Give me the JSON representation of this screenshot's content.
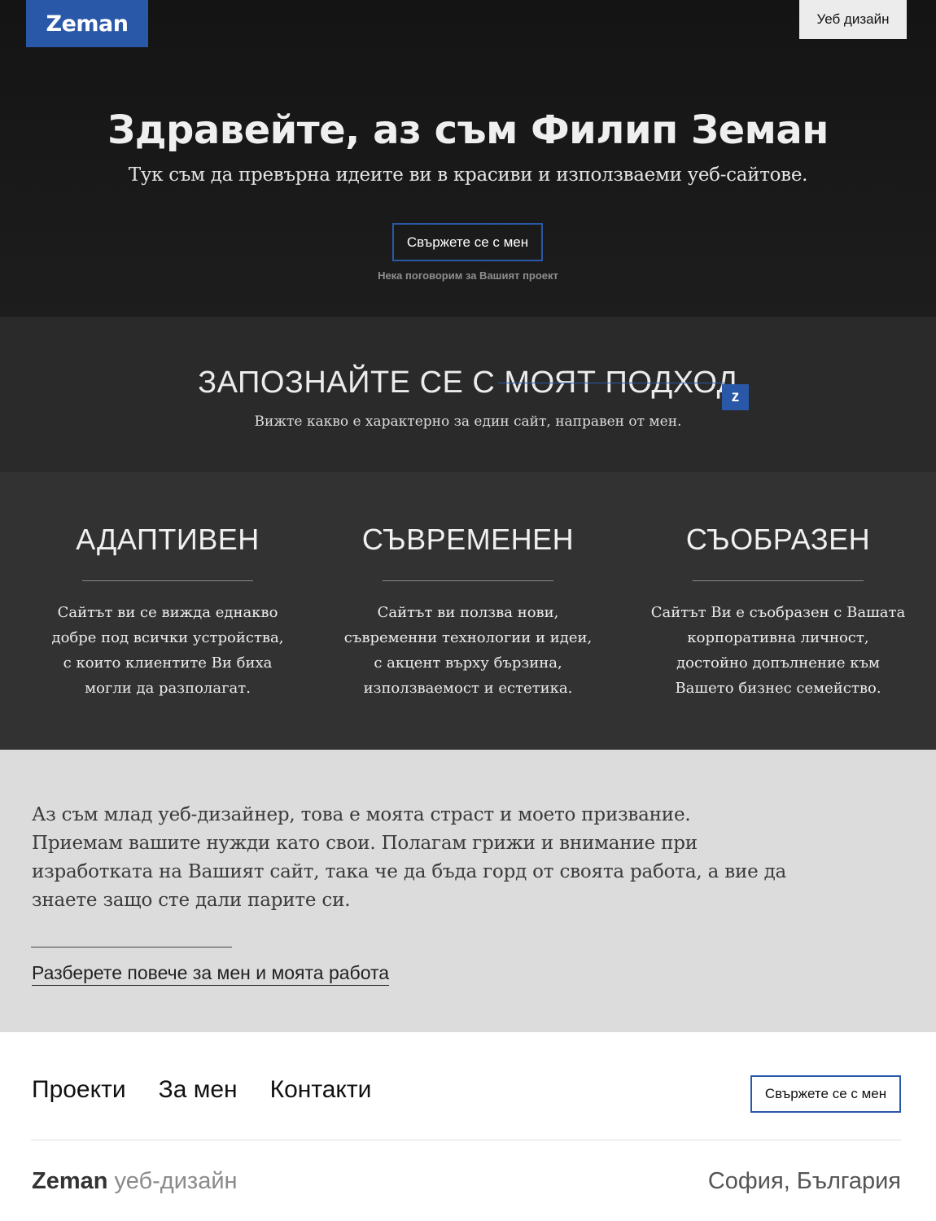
{
  "header": {
    "logo": "Zeman",
    "top_button": "Уеб дизайн"
  },
  "hero": {
    "title_bold": "Здравейте,",
    "title_rest": " аз съм Филип Земан",
    "subtitle": "Тук съм да превърна идеите ви в красиви и използваеми уеб-сайтове.",
    "cta": "Свържете се с мен",
    "note": "Нека поговорим за Вашият проект"
  },
  "approach": {
    "title": "ЗАПОЗНАЙТЕ СЕ С МОЯТ ПОДХОД",
    "badge": "z",
    "subtitle": "Вижте какво е характерно за един сайт, направен от мен."
  },
  "features": [
    {
      "title": "АДАПТИВЕН",
      "lines": [
        "Сайтът ви се вижда еднакво",
        "добре под всички устройства,",
        "с които клиентите Ви биха",
        "могли да разполагат."
      ]
    },
    {
      "title": "СЪВРЕМЕНЕН",
      "lines": [
        "Сайтът ви ползва нови,",
        "съвременни технологии и идеи,",
        "с акцент върху бързина,",
        "използваемост и естетика."
      ]
    },
    {
      "title": "СЪОБРАЗЕН",
      "lines": [
        "Сайтът Ви е съобразен с Вашата",
        "корпоративна личност,",
        "достойно допълнение към",
        "Вашето бизнес семейство."
      ]
    }
  ],
  "about": {
    "lines": [
      "Аз съм млад уеб-дизайнер, това е моята страст и моето призвание.",
      "Приемам вашите нужди като свои. Полагам грижи и внимание при",
      "изработката на Вашият сайт, така че да бъда горд от своята работа, а вие да",
      "знаете защо сте дали парите си."
    ],
    "link": "Разберете повече за мен и моята работа"
  },
  "footer": {
    "nav": [
      "Проекти",
      "За мен",
      "Контакти"
    ],
    "cta": "Свържете се с мен",
    "brand": "Zeman",
    "brand_desc": " уеб-дизайн",
    "location": "София, България"
  },
  "colors": {
    "accent": "#2a58a8",
    "hero_bg": "#161616",
    "approach_bg": "#2a2a2a",
    "features_bg": "#323232",
    "about_bg": "#dcdcdc"
  }
}
